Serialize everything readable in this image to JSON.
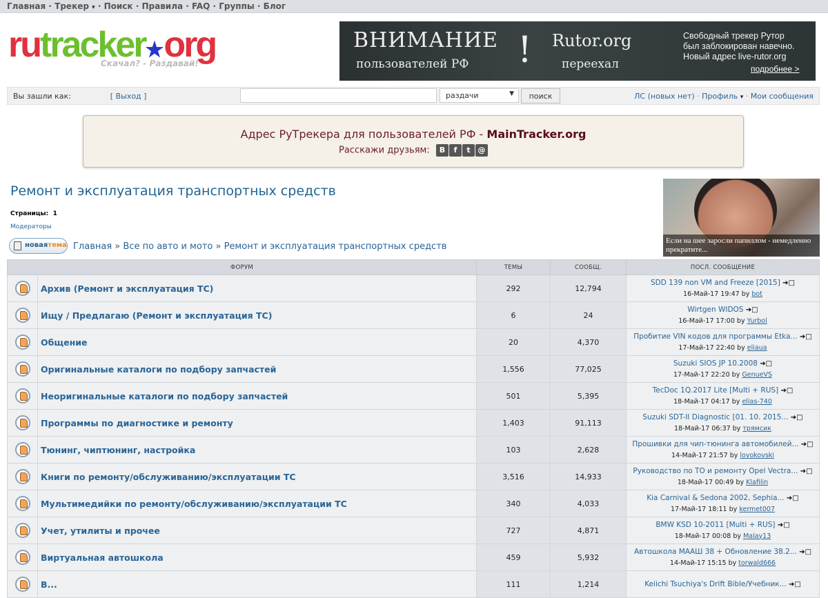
{
  "topnav": [
    "Главная",
    "Трекер",
    "Поиск",
    "Правила",
    "FAQ",
    "Группы",
    "Блог"
  ],
  "logo": {
    "text_ru": "ru",
    "text_tracker": "tracker",
    "text_org": "org",
    "slogan": "Скачал? - Раздавай!"
  },
  "banner": {
    "line1": "ВНИМАНИЕ",
    "line2": "пользователей РФ",
    "exclaim": "!",
    "site": "Rutor.org",
    "moved": "переехал",
    "info": "Свободный трекер Рутор был заблокирован навечно. Новый адрес live-rutor.org",
    "more": "подробнее >"
  },
  "loginbar": {
    "logged_as": "Вы зашли как:",
    "logout": "[ Выход ]",
    "search_value": "",
    "select_value": "раздачи",
    "search_button": "поиск",
    "pm": "ЛС (новых нет)",
    "profile": "Профиль",
    "my_messages": "Мои сообщения"
  },
  "notice": {
    "text": "Адрес РуТрекера для пользователей РФ -",
    "link": "MainTracker.org",
    "share": "Расскажи друзьям:",
    "social": [
      "B",
      "f",
      "t",
      "@"
    ]
  },
  "page": {
    "title": "Ремонт и эксплуатация транспортных средств",
    "pages_label": "Страницы:",
    "pages_value": "1",
    "moderators": "Модераторы",
    "new_topic_a": "новая",
    "new_topic_b": "тема"
  },
  "breadcrumb": [
    "Главная",
    "Все по авто и мото",
    "Ремонт и эксплуатация транспортных средств"
  ],
  "ad": {
    "caption": "Если на шее заросли папиллом - немедленно прекратите..."
  },
  "table": {
    "headers": [
      "ФОРУМ",
      "ТЕМЫ",
      "СООБЩ.",
      "ПОСЛ. СООБЩЕНИЕ"
    ],
    "rows": [
      {
        "name": "Архив (Ремонт и эксплуатация ТС)",
        "topics": "292",
        "posts": "12,794",
        "last_title": "SDD 139 non VM and Freeze [2015]",
        "last_time": "16-Май-17 19:47",
        "by": "by",
        "last_user": "bot"
      },
      {
        "name": "Ищу / Предлагаю (Ремонт и эксплуатация ТС)",
        "topics": "6",
        "posts": "24",
        "last_title": "Wirtgen WIDOS",
        "last_time": "16-Май-17 17:00",
        "by": "by",
        "last_user": "Yurbol"
      },
      {
        "name": "Общение",
        "topics": "20",
        "posts": "4,370",
        "last_title": "Пробитие VIN кодов для программы Etka...",
        "last_time": "17-Май-17 22:40",
        "by": "by",
        "last_user": "eliaua"
      },
      {
        "name": "Оригинальные каталоги по подбору запчастей",
        "topics": "1,556",
        "posts": "77,025",
        "last_title": "Suzuki SIOS JP 10.2008",
        "last_time": "17-Май-17 22:20",
        "by": "by",
        "last_user": "GenueVS"
      },
      {
        "name": "Неоригинальные каталоги по подбору запчастей",
        "topics": "501",
        "posts": "5,395",
        "last_title": "TecDoc 1Q.2017 Lite [Multi + RUS]",
        "last_time": "18-Май-17 04:17",
        "by": "by",
        "last_user": "elias-740"
      },
      {
        "name": "Программы по диагностике и ремонту",
        "topics": "1,403",
        "posts": "91,113",
        "last_title": "Suzuki SDT-II Diagnostic [01. 10. 2015...",
        "last_time": "18-Май-17 06:37",
        "by": "by",
        "last_user": "трямсик"
      },
      {
        "name": "Тюнинг, чиптюнинг, настройка",
        "topics": "103",
        "posts": "2,628",
        "last_title": "Прошивки для чип-тюнинга автомобилей...",
        "last_time": "14-Май-17 21:57",
        "by": "by",
        "last_user": "lovokovski"
      },
      {
        "name": "Книги по ремонту/обслуживанию/эксплуатации ТС",
        "topics": "3,516",
        "posts": "14,933",
        "last_title": "Руководство по ТО и ремонту Opel Vectra...",
        "last_time": "18-Май-17 00:49",
        "by": "by",
        "last_user": "Klafilin"
      },
      {
        "name": "Мультимедийки по ремонту/обслуживанию/эксплуатации ТС",
        "topics": "340",
        "posts": "4,033",
        "last_title": "Kia Carnival & Sedona 2002, Sephia...",
        "last_time": "17-Май-17 18:11",
        "by": "by",
        "last_user": "kermet007"
      },
      {
        "name": "Учет, утилиты и прочее",
        "topics": "727",
        "posts": "4,871",
        "last_title": "BMW KSD 10-2011 [Multi + RUS]",
        "last_time": "18-Май-17 00:08",
        "by": "by",
        "last_user": "Malay13"
      },
      {
        "name": "Виртуальная автошкола",
        "topics": "459",
        "posts": "5,932",
        "last_title": "Автошкола МААШ 38 + Обновление 38.2...",
        "last_time": "14-Май-17 15:15",
        "by": "by",
        "last_user": "torwald666"
      },
      {
        "name": "В...",
        "topics": "111",
        "posts": "1,214",
        "last_title": "Keiichi Tsuchiya's Drift Bible/Учебник...",
        "last_time": "",
        "by": "",
        "last_user": ""
      }
    ]
  }
}
